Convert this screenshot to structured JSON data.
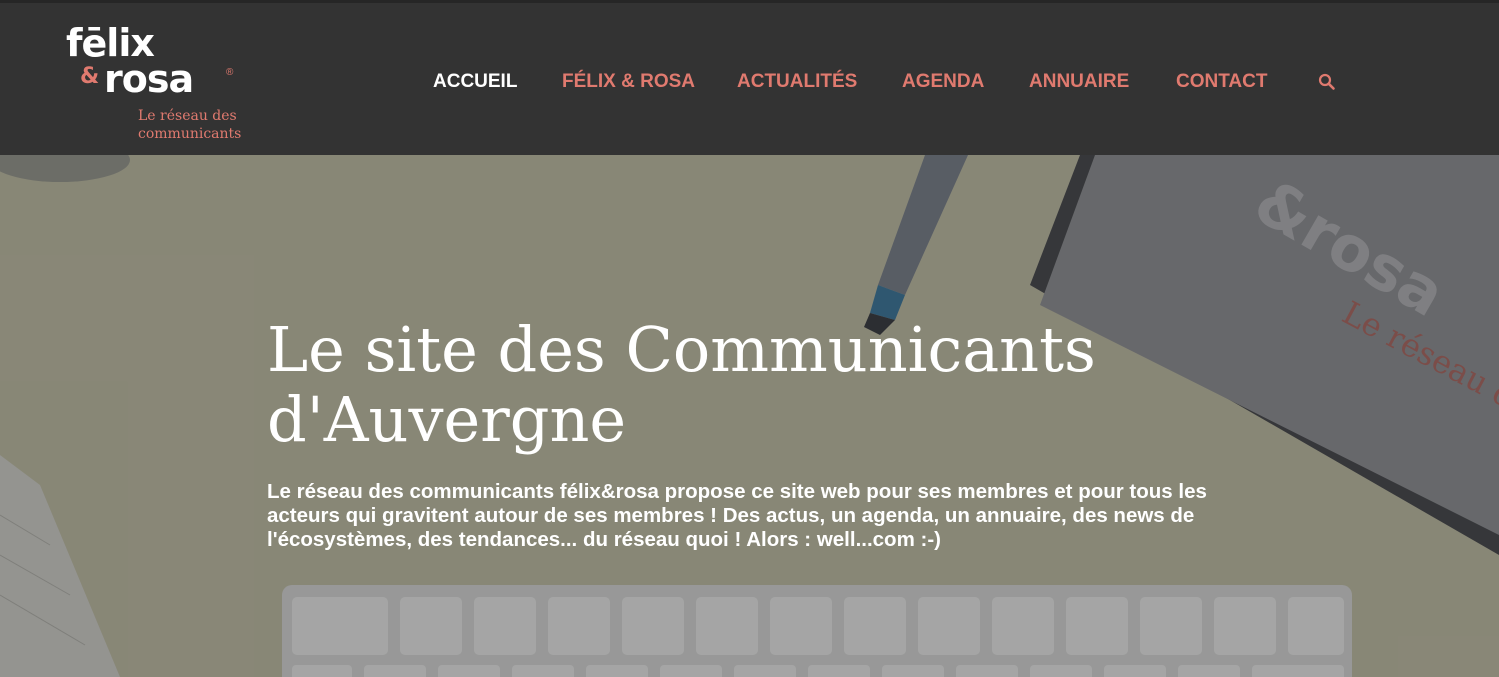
{
  "logo": {
    "line1": "fēlix",
    "ampersand": "&",
    "line2": "rosa",
    "registered": "®",
    "tagline": "Le réseau des communicants"
  },
  "nav": {
    "items": [
      {
        "label": "ACCUEIL",
        "active": true
      },
      {
        "label": "FÉLIX & ROSA",
        "active": false
      },
      {
        "label": "ACTUALITÉS",
        "active": false
      },
      {
        "label": "AGENDA",
        "active": false
      },
      {
        "label": "ANNUAIRE",
        "active": false
      },
      {
        "label": "CONTACT",
        "active": false
      }
    ],
    "search_icon": "search-icon"
  },
  "hero": {
    "title": "Le site des Communicants d'Auvergne",
    "text": "Le réseau des communicants félix&rosa propose ce site web pour ses membres et pour tous les acteurs qui gravitent autour de ses membres ! Des actus, un agenda, un annuaire, des news de l'écosystèmes, des tendances... du réseau quoi ! Alors : well...com :-)",
    "bg_notebook_brand": "&rosa",
    "bg_notebook_tagline": "Le réseau des communicants"
  },
  "colors": {
    "header_bg": "#333333",
    "accent": "#e07a6f",
    "active_nav": "#ffffff"
  }
}
